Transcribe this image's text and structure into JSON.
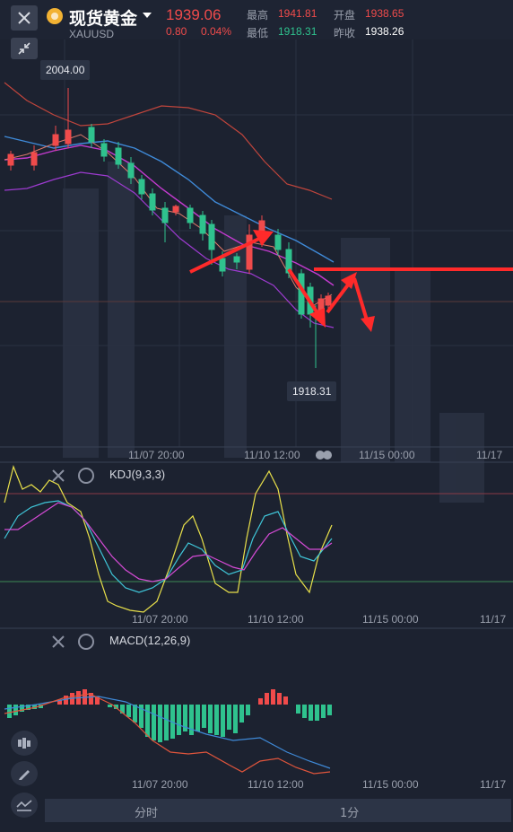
{
  "header": {
    "symbol_name": "现货黄金",
    "symbol_code": "XAUUSD",
    "price": "1939.06",
    "change": "0.80",
    "change_pct": "0.04%",
    "high_label": "最高",
    "high_value": "1941.81",
    "low_label": "最低",
    "low_value": "1918.31",
    "open_label": "开盘",
    "open_value": "1938.65",
    "prev_close_label": "昨收",
    "prev_close_value": "1938.26"
  },
  "main_chart": {
    "high_tag": "2004.00",
    "low_tag": "1918.31",
    "time_labels": [
      "11/07 20:00",
      "11/10 12:00",
      "11/15 00:00",
      "11/17"
    ]
  },
  "kdj": {
    "title": "KDJ(9,3,3)",
    "time_labels": [
      "11/07 20:00",
      "11/10 12:00",
      "11/15 00:00",
      "11/17"
    ]
  },
  "macd": {
    "title": "MACD(12,26,9)",
    "time_labels": [
      "11/07 20:00",
      "11/10 12:00",
      "11/15 00:00",
      "11/17"
    ]
  },
  "bottom_tabs": [
    "分时",
    "1分"
  ],
  "colors": {
    "up": "#f04b4b",
    "down": "#2fc28e",
    "k_line": "#e8e04a",
    "d_line": "#3fc6d8",
    "j_line": "#d64bd6",
    "annotation": "#ff2a2a"
  }
}
